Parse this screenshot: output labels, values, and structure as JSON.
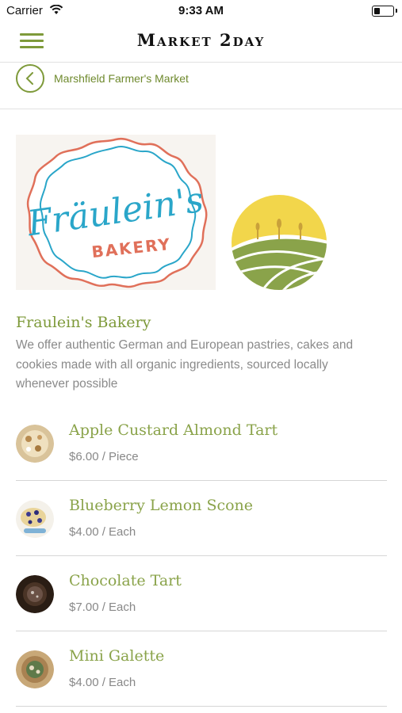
{
  "status_bar": {
    "carrier": "Carrier",
    "time": "9:33 AM"
  },
  "header": {
    "title": "Market 2day",
    "menu_icon": "hamburger-icon"
  },
  "breadcrumb": {
    "back_icon": "chevron-left-icon",
    "label": "Marshfield Farmer's Market"
  },
  "vendor": {
    "name": "Fraulein's Bakery",
    "description": "We offer authentic German and European pastries, cakes and cookies made with all organic ingredients, sourced locally whenever possible",
    "logo": {
      "text_main": "Fräulein's",
      "text_sub": "BAKERY"
    }
  },
  "products": [
    {
      "name": "Apple Custard Almond Tart",
      "price": "$6.00 / Piece"
    },
    {
      "name": "Blueberry Lemon Scone",
      "price": "$4.00 / Each"
    },
    {
      "name": "Chocolate Tart",
      "price": "$7.00 / Each"
    },
    {
      "name": "Mini Galette",
      "price": "$4.00 / Each"
    }
  ],
  "colors": {
    "accent_green": "#7e9a3a",
    "logo_blue": "#2aa6c9",
    "logo_red": "#e0705a",
    "badge_yellow": "#f2d64b"
  }
}
